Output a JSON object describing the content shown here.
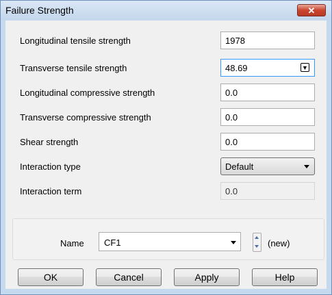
{
  "window": {
    "title": "Failure Strength",
    "close_glyph": "✕"
  },
  "fields": [
    {
      "label": "Longitudinal tensile strength",
      "value": "1978"
    },
    {
      "label": "Transverse tensile strength",
      "value": "48.69"
    },
    {
      "label": "Longitudinal compressive strength",
      "value": "0.0"
    },
    {
      "label": "Transverse compressive strength",
      "value": "0.0"
    },
    {
      "label": "Shear strength",
      "value": "0.0"
    }
  ],
  "interaction_type": {
    "label": "Interaction type",
    "selected": "Default"
  },
  "interaction_term": {
    "label": "Interaction term",
    "value": "0.0"
  },
  "name_group": {
    "label": "Name",
    "value": "CF1",
    "status": "(new)"
  },
  "buttons": {
    "ok": "OK",
    "cancel": "Cancel",
    "apply": "Apply",
    "help": "Help"
  },
  "icons": {
    "field_picker": "field-picker-icon",
    "close": "close-icon"
  }
}
